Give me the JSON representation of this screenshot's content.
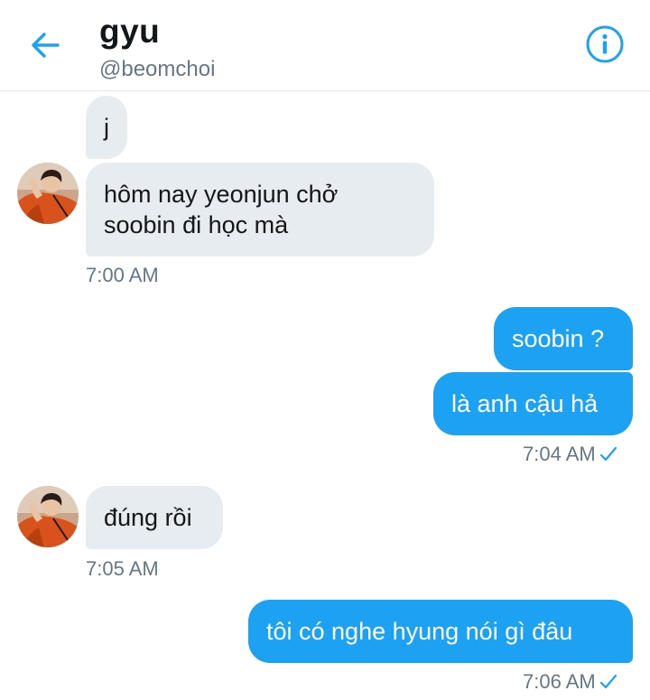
{
  "header": {
    "title": "gyu",
    "handle": "@beomchoi"
  },
  "icons": {
    "back": "arrow-left-icon",
    "info": "info-icon",
    "read": "checkmark-icon"
  },
  "colors": {
    "accent": "#1da1f2",
    "incoming_bubble": "#e6ecf0",
    "timestamp": "#657786"
  },
  "messages": [
    {
      "direction": "incoming",
      "text": "j"
    },
    {
      "direction": "incoming",
      "text_line1": "hôm nay yeonjun chở",
      "text_line2": "soobin đi học mà"
    },
    {
      "direction": "outgoing",
      "text": "soobin ?"
    },
    {
      "direction": "outgoing",
      "text": "là anh cậu hả"
    },
    {
      "direction": "incoming",
      "text": "đúng rồi"
    },
    {
      "direction": "outgoing",
      "text": "tôi có nghe hyung nói gì đâu"
    }
  ],
  "timestamps": [
    "7:00 AM",
    "7:04 AM",
    "7:05 AM",
    "7:06 AM"
  ]
}
